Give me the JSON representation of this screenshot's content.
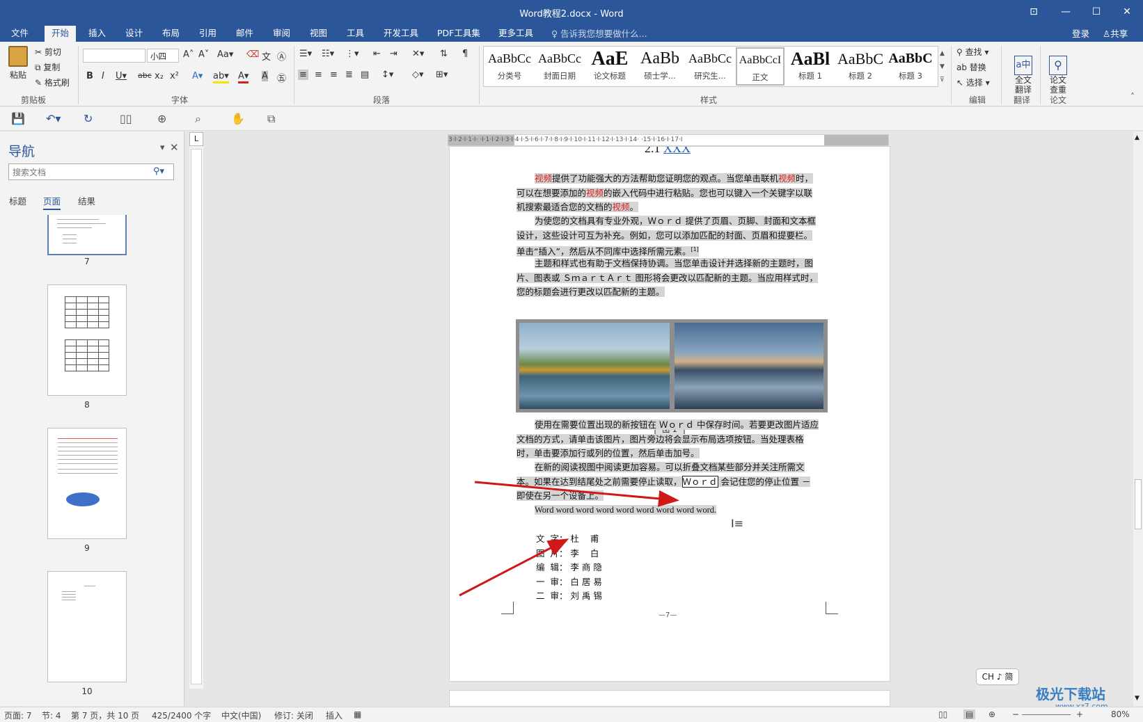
{
  "window": {
    "title": "Word教程2.docx - Word",
    "controls": [
      "⊡",
      "—",
      "☐",
      "✕"
    ]
  },
  "tabs": [
    "文件",
    "开始",
    "插入",
    "设计",
    "布局",
    "引用",
    "邮件",
    "审阅",
    "视图",
    "工具",
    "开发工具",
    "PDF工具集",
    "更多工具"
  ],
  "tell_me": "告诉我您想要做什么...",
  "account": {
    "login": "登录",
    "share": "共享"
  },
  "ribbon": {
    "clipboard": {
      "paste": "粘贴",
      "cut": "剪切",
      "copy": "复制",
      "format_painter": "格式刷",
      "label": "剪贴板"
    },
    "font": {
      "font_name": "",
      "font_size": "小四",
      "label": "字体"
    },
    "paragraph": {
      "label": "段落"
    },
    "styles": {
      "label": "样式",
      "items": [
        {
          "preview": "AaBbCc",
          "name": "分类号"
        },
        {
          "preview": "AaBbCc",
          "name": "封面日期"
        },
        {
          "preview": "AaE",
          "name": "论文标题"
        },
        {
          "preview": "AaBb",
          "name": "硕士学..."
        },
        {
          "preview": "AaBbCc",
          "name": "研究生..."
        },
        {
          "preview": "AaBbCcI",
          "name": "正文"
        },
        {
          "preview": "AaBl",
          "name": "标题 1"
        },
        {
          "preview": "AaBbC",
          "name": "标题 2"
        },
        {
          "preview": "AaBbC",
          "name": "标题 3"
        }
      ]
    },
    "editing": {
      "find": "查找",
      "replace": "替换",
      "select": "选择",
      "label": "编辑"
    },
    "translate": {
      "button": "全文\n翻译",
      "label": "翻译"
    },
    "paper": {
      "button": "论文\n查重",
      "label": "论文"
    }
  },
  "nav": {
    "title": "导航",
    "search_placeholder": "搜索文档",
    "tabs": [
      "标题",
      "页面",
      "结果"
    ],
    "pages": [
      "7",
      "8",
      "9",
      "10"
    ]
  },
  "ruler": {
    "text": "3·I·2·I·1·I·  ·I·1·I·2·I·3·I·4·I·5·I·6·I·7·I·8·I·9·I·10·I·11·I·12·I·13·I·14·  ·15·I·16·I·17·I"
  },
  "document": {
    "heading_prefix": "2.1 ",
    "heading_link": "XXX",
    "p1_parts": [
      "视频",
      "提供了功能强大的方法帮助您证明您的观点。当您单击联机",
      "视频",
      "时，可以在想要添加的",
      "视频",
      "的嵌入代码中进行粘贴。您也可以键入一个关键字以联机搜索最适合您的文档的",
      "视频",
      "。"
    ],
    "p2": "为使您的文档具有专业外观，Ｗｏｒｄ 提供了页眉、页脚、封面和文本框设计，这些设计可互为补充。例如，您可以添加匹配的封面、页眉和提要栏。单击“插入”，然后从不同库中选择所需元素。",
    "p2_ref": "[1]",
    "p3": "主题和样式也有助于文档保持协调。当您单击设计并选择新的主题时，图片、图表或 ＳｍａｒｔＡｒｔ 图形将会更改以匹配新的主题。当应用样式时，您的标题会进行更改以匹配新的主题。",
    "caption": "图 1",
    "p4": "使用在需要位置出现的新按钮在 Ｗｏｒｄ 中保存时间。若要更改图片适应文档的方式，请单击该图片，图片旁边将会显示布局选项按钮。当处理表格时，单击要添加行或列的位置，然后单击加号。",
    "p5_a": "在新的阅读视图中阅读更加容易。可以折叠文档某些部分并关注所需文本。如果在达到结尾处之前需要停止读取，",
    "p5_word": "Ｗｏｒｄ",
    "p5_b": " 会记住您的停止位置 － 即使在另一个设备上。",
    "p6": "Word word word word word word word word word.",
    "credits": [
      "文  字： 杜    甫",
      "图  片： 李    白",
      "编  辑： 李 商 隐",
      "一  审： 白 居 易",
      "二  审： 刘 禹 锡"
    ],
    "page_footer": "—7—"
  },
  "status": {
    "page": "页面: 7",
    "section": "节: 4",
    "pages": "第 7 页，共 10 页",
    "words": "425/2400 个字",
    "lang": "中文(中国)",
    "track": "修订: 关闭",
    "mode": "插入",
    "zoom": "80%"
  },
  "ime": "CH ♪ 简",
  "watermark": {
    "name": "极光下载站",
    "url": "www.xz7.com"
  }
}
